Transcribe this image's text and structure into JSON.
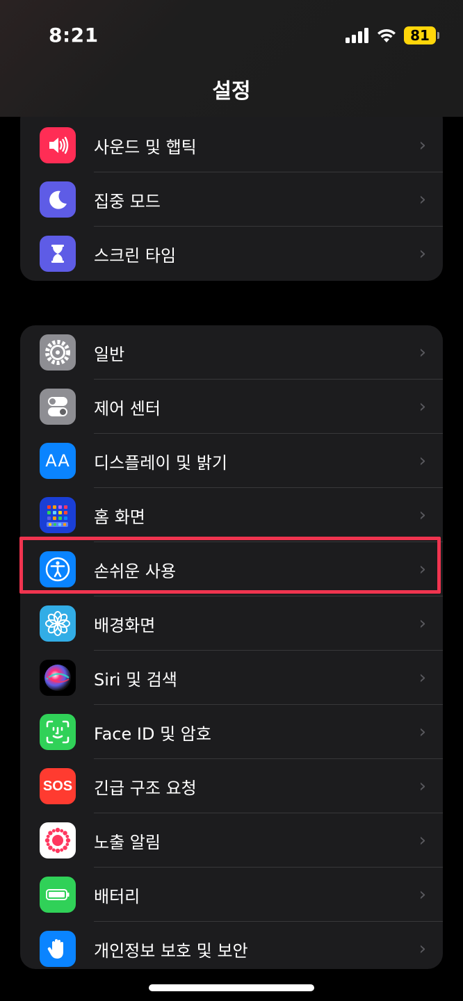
{
  "status": {
    "time": "8:21",
    "battery": "81"
  },
  "nav": {
    "title": "설정"
  },
  "group1": [
    {
      "label": "사운드 및 햅틱",
      "icon": "speaker-icon",
      "color": "#ff2d55"
    },
    {
      "label": "집중 모드",
      "icon": "moon-icon",
      "color": "#5e5ce6"
    },
    {
      "label": "스크린 타임",
      "icon": "hourglass-icon",
      "color": "#5e5ce6"
    }
  ],
  "group2": [
    {
      "label": "일반",
      "icon": "gear-icon",
      "color": "#8e8e93"
    },
    {
      "label": "제어 센터",
      "icon": "toggles-icon",
      "color": "#8e8e93"
    },
    {
      "label": "디스플레이 및 밝기",
      "icon": "text-size-icon",
      "color": "#0a84ff",
      "icon_text": "AA"
    },
    {
      "label": "홈 화면",
      "icon": "home-grid-icon",
      "color": "#0a60ff"
    },
    {
      "label": "손쉬운 사용",
      "icon": "accessibility-icon",
      "color": "#0a84ff",
      "highlighted": true
    },
    {
      "label": "배경화면",
      "icon": "flower-icon",
      "color": "#32ade6"
    },
    {
      "label": "Siri 및 검색",
      "icon": "siri-icon",
      "color": "#1c1c1e"
    },
    {
      "label": "Face ID 및 암호",
      "icon": "face-id-icon",
      "color": "#30d158"
    },
    {
      "label": "긴급 구조 요청",
      "icon": "sos-icon",
      "color": "#ff3b30",
      "icon_text": "SOS"
    },
    {
      "label": "노출 알림",
      "icon": "exposure-icon",
      "color": "#ffffff"
    },
    {
      "label": "배터리",
      "icon": "battery-icon",
      "color": "#30d158"
    },
    {
      "label": "개인정보 보호 및 보안",
      "icon": "hand-icon",
      "color": "#0a84ff"
    }
  ]
}
